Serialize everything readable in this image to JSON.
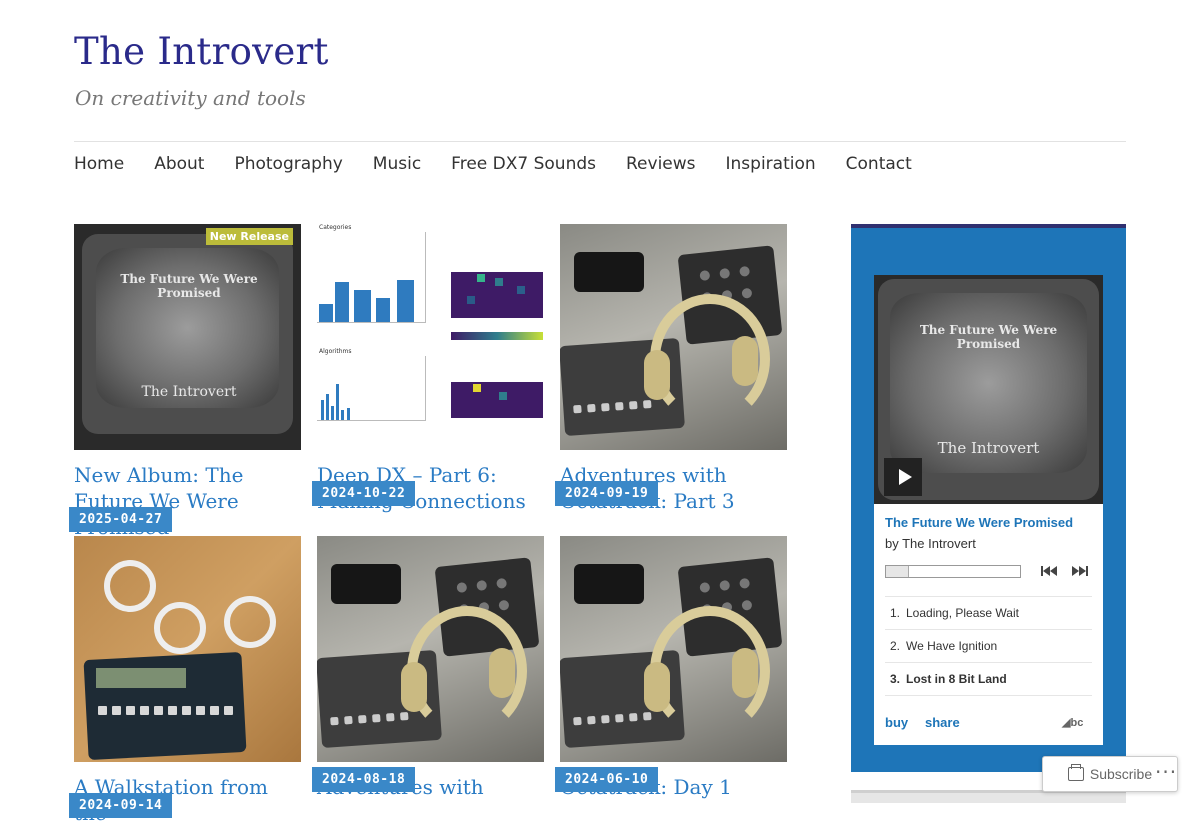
{
  "site": {
    "title": "The Introvert",
    "tagline": "On creativity and tools"
  },
  "nav": [
    "Home",
    "About",
    "Photography",
    "Music",
    "Free DX7 Sounds",
    "Reviews",
    "Inspiration",
    "Contact"
  ],
  "posts": [
    {
      "date": "2025-04-27",
      "title": "New Album: The Future We Were Promised",
      "thumb_text": {
        "badge": "New Release",
        "top": "The Future We Were Promised",
        "bottom": "The Introvert"
      }
    },
    {
      "date": "2024-10-22",
      "title": "Deep DX – Part 6: Making Connections",
      "thumb_text": {
        "a": "Categories",
        "b": "Algorithms"
      }
    },
    {
      "date": "2024-09-19",
      "title": "Adventures with Octatrack: Part 3"
    },
    {
      "date": "2024-09-14",
      "title": "A Walkstation from the"
    },
    {
      "date": "2024-08-18",
      "title": "Adventures with"
    },
    {
      "date": "2024-06-10",
      "title": "Octatrack: Day 1"
    }
  ],
  "bandcamp": {
    "art_text": {
      "top": "The Future We Were Promised",
      "bottom": "The Introvert"
    },
    "album": "The Future We Were Promised",
    "by": "by The Introvert",
    "tracks": [
      {
        "num": "1.",
        "title": "Loading, Please Wait"
      },
      {
        "num": "2.",
        "title": "We Have Ignition"
      },
      {
        "num": "3.",
        "title": "Lost in 8 Bit Land"
      }
    ],
    "buy": "buy",
    "share": "share",
    "logo": "bc"
  },
  "subscribe": "Subscribe",
  "more": "···"
}
